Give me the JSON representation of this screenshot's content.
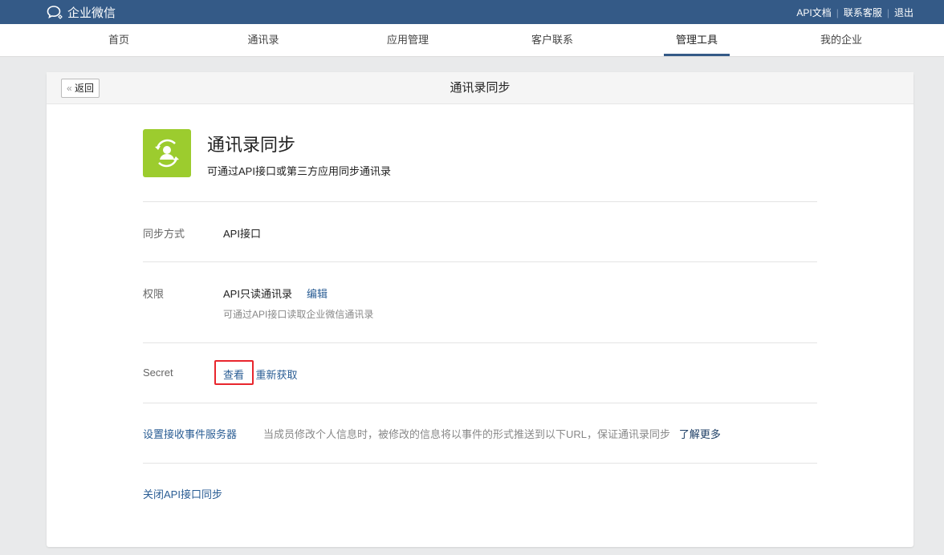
{
  "header": {
    "logo": "企业微信",
    "links": [
      "API文档",
      "联系客服",
      "退出"
    ]
  },
  "nav": [
    {
      "label": "首页"
    },
    {
      "label": "通讯录"
    },
    {
      "label": "应用管理"
    },
    {
      "label": "客户联系"
    },
    {
      "label": "管理工具",
      "active": true
    },
    {
      "label": "我的企业"
    }
  ],
  "page": {
    "back": "返回",
    "title": "通讯录同步"
  },
  "app": {
    "title": "通讯录同步",
    "desc": "可通过API接口或第三方应用同步通讯录",
    "icon": "contact-sync-icon",
    "color": "#9ccc2e"
  },
  "rows": {
    "sync_label": "同步方式",
    "sync_value": "API接口",
    "perm_label": "权限",
    "perm_value": "API只读通讯录",
    "perm_edit": "编辑",
    "perm_desc": "可通过API接口读取企业微信通讯录",
    "secret_label": "Secret",
    "secret_view": "查看",
    "secret_refresh": "重新获取",
    "event_link": "设置接收事件服务器",
    "event_desc": "当成员修改个人信息时，被修改的信息将以事件的形式推送到以下URL，保证通讯录同步",
    "event_more": "了解更多",
    "close_link": "关闭API接口同步"
  }
}
